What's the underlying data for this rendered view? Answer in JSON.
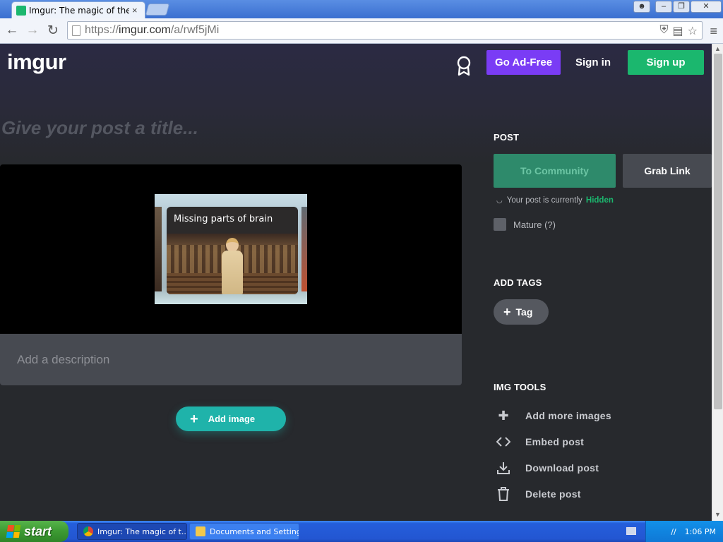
{
  "browser": {
    "tab_title": "Imgur: The magic of the Inte",
    "tab_close": "×",
    "url_scheme": "https://",
    "url_host": "imgur.com",
    "url_path": "/a/rwf5jMi",
    "back_icon": "arrow-left",
    "forward_icon": "arrow-right",
    "reload_icon": "reload",
    "menu_icon": "hamburger"
  },
  "header": {
    "logo": "imgur",
    "ad_free": "Go Ad-Free",
    "sign_in": "Sign in",
    "sign_up": "Sign up"
  },
  "post": {
    "title_placeholder": "Give your post a title...",
    "image_caption": "Missing parts of brain",
    "description_placeholder": "Add a description",
    "add_image": "Add image"
  },
  "sidebar": {
    "post_heading": "POST",
    "to_community": "To Community",
    "grab_link": "Grab Link",
    "visibility_prefix": "Your post is currently",
    "visibility_status": "Hidden",
    "mature_label": "Mature (?)",
    "tags_heading": "ADD TAGS",
    "tag_button": "Tag",
    "tools_heading": "IMG TOOLS",
    "tools": [
      {
        "label": "Add more images",
        "icon": "plus-icon"
      },
      {
        "label": "Embed post",
        "icon": "code-icon"
      },
      {
        "label": "Download post",
        "icon": "download-icon"
      },
      {
        "label": "Delete post",
        "icon": "trash-icon"
      }
    ]
  },
  "colors": {
    "accent_green": "#1bb76e",
    "ad_free_purple": "#7a3cf5",
    "add_image_teal": "#1fb3aa"
  },
  "taskbar": {
    "start": "start",
    "tasks": [
      {
        "label": "Imgur: The magic of t..."
      },
      {
        "label": "Documents and Settings"
      }
    ],
    "clock": "1:06 PM"
  }
}
